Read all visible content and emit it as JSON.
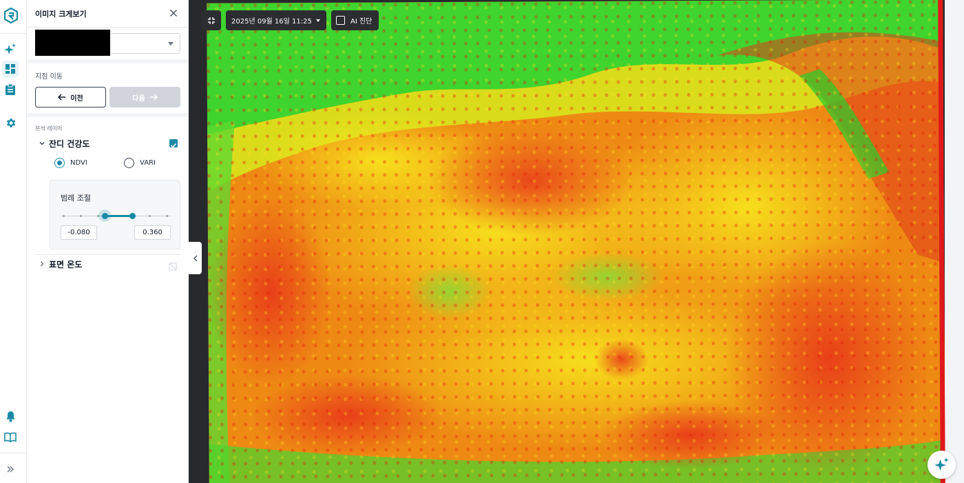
{
  "panel": {
    "title": "이미지 크게보기",
    "move_label": "지점 이동",
    "prev_label": "이전",
    "next_label": "다음",
    "layers_label": "분석 레이어",
    "layer_health": "잔디 건강도",
    "layer_health_checked": true,
    "radio_ndvi": "NDVI",
    "radio_vari": "VARI",
    "radio_selected": "NDVI",
    "legend_title": "범례 조절",
    "range_min": "-0.080",
    "range_max": "0.360",
    "range_selected_fraction": [
      0.4,
      0.65
    ],
    "layer_temp": "표면 온도",
    "layer_temp_checked": false
  },
  "toolbar": {
    "date_label": "2025년 09월 16일 11:25",
    "ai_label": "AI 진단",
    "ai_checked": false
  },
  "colors": {
    "accent": "#1a8aa5",
    "ndvi_low": "#e0181c",
    "ndvi_mid": "#f5e61c",
    "ndvi_high": "#3fdc30"
  },
  "icons": {
    "logo": "app-logo-icon",
    "nav": [
      "sparkle-icon",
      "dashboard-icon",
      "clipboard-icon",
      "gear-icon",
      "bell-icon",
      "book-icon",
      "double-chevron-right-icon"
    ]
  }
}
